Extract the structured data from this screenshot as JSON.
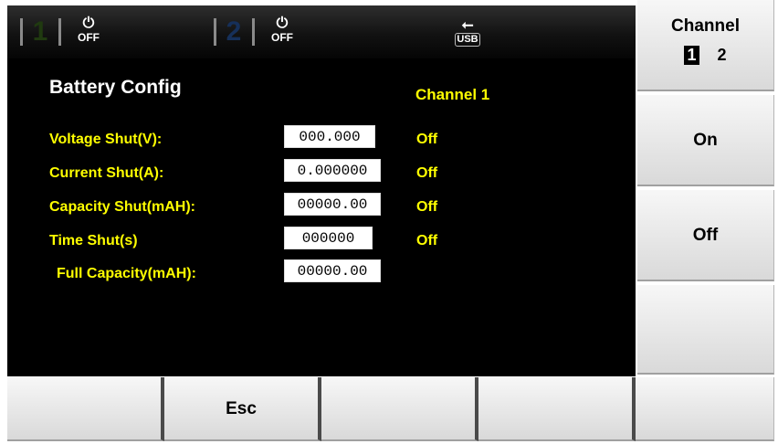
{
  "statusbar": {
    "ch1_number": "1",
    "ch1_power_text": "OFF",
    "ch2_number": "2",
    "ch2_power_text": "OFF",
    "usb_text": "USB",
    "icons": [
      "power-icon",
      "power-icon",
      "usb-icon"
    ]
  },
  "page": {
    "title": "Battery Config",
    "channel_label": "Channel 1"
  },
  "rows": [
    {
      "label": "Voltage Shut(V):",
      "value": "000.000",
      "state": "Off"
    },
    {
      "label": "Current Shut(A):",
      "value": "0.000000",
      "state": "Off"
    },
    {
      "label": "Capacity Shut(mAH):",
      "value": "00000.00",
      "state": "Off"
    },
    {
      "label": "Time Shut(s)",
      "value": "000000",
      "state": "Off"
    },
    {
      "label": "Full Capacity(mAH):",
      "value": "00000.00"
    }
  ],
  "softkeys": {
    "channel_title": "Channel",
    "channel_opt1": "1",
    "channel_opt2": "2",
    "on": "On",
    "off": "Off"
  },
  "bottom_keys": [
    "",
    "Esc",
    "",
    "",
    ""
  ],
  "colors": {
    "label_yellow": "#ffff00",
    "ch1_color": "#203a10",
    "ch2_color": "#16305a"
  }
}
